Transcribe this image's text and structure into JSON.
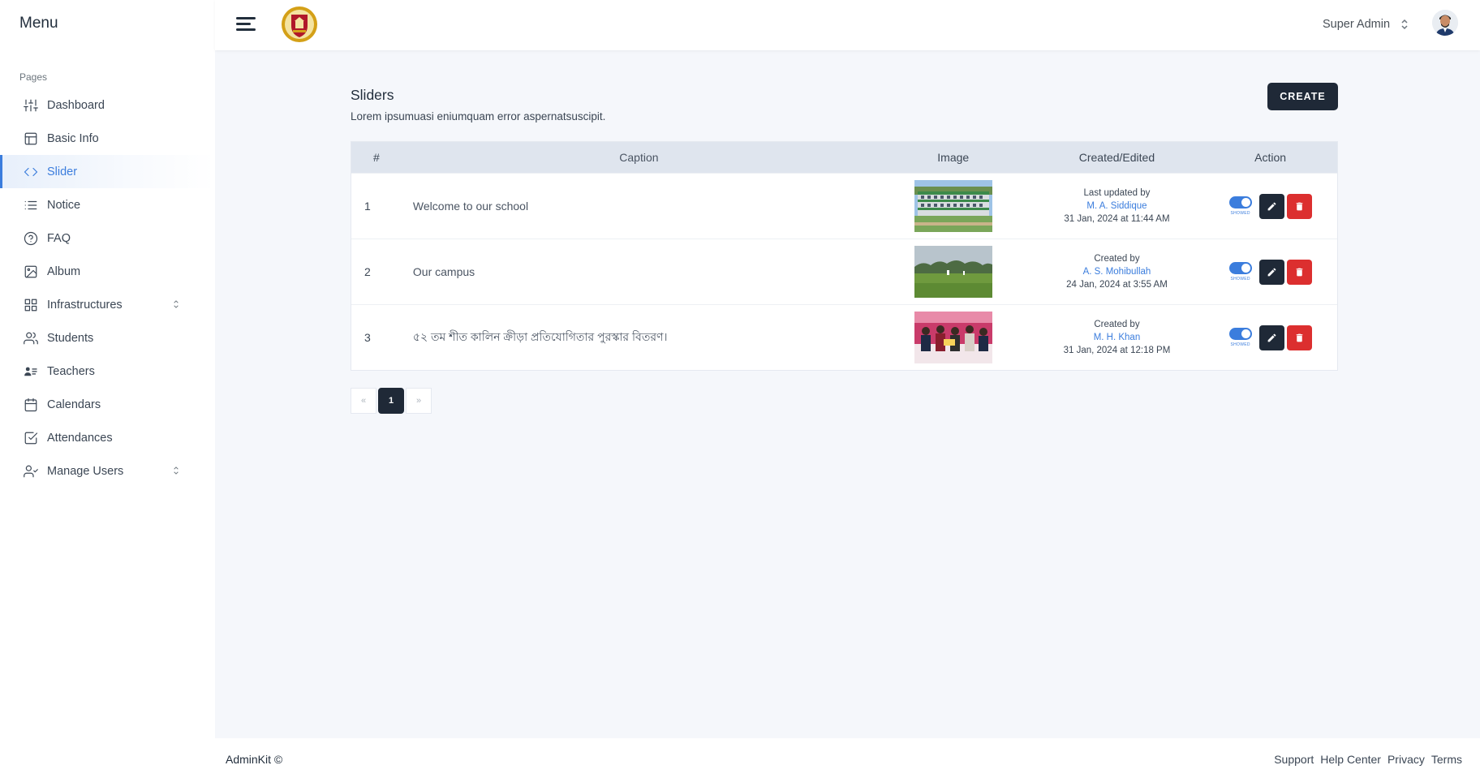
{
  "sidebar": {
    "title": "Menu",
    "section_label": "Pages",
    "items": [
      {
        "label": "Dashboard",
        "icon": "sliders-icon"
      },
      {
        "label": "Basic Info",
        "icon": "layout-icon"
      },
      {
        "label": "Slider",
        "icon": "code-icon",
        "active": true
      },
      {
        "label": "Notice",
        "icon": "list-icon"
      },
      {
        "label": "FAQ",
        "icon": "help-circle-icon"
      },
      {
        "label": "Album",
        "icon": "image-icon"
      },
      {
        "label": "Infrastructures",
        "icon": "grid-icon",
        "expandable": true
      },
      {
        "label": "Students",
        "icon": "users-icon"
      },
      {
        "label": "Teachers",
        "icon": "id-card-icon"
      },
      {
        "label": "Calendars",
        "icon": "calendar-icon"
      },
      {
        "label": "Attendances",
        "icon": "check-square-icon"
      },
      {
        "label": "Manage Users",
        "icon": "user-check-icon",
        "expandable": true
      }
    ]
  },
  "header": {
    "user_name": "Super Admin"
  },
  "page": {
    "title": "Sliders",
    "description": "Lorem ipsumuasi eniumquam error aspernatsuscipit.",
    "create_label": "CREATE"
  },
  "table": {
    "headers": {
      "num": "#",
      "caption": "Caption",
      "image": "Image",
      "created": "Created/Edited",
      "action": "Action"
    },
    "rows": [
      {
        "num": "1",
        "caption": "Welcome to our school",
        "created_label": "Last updated by",
        "by": "M. A. Siddique",
        "date": "31 Jan, 2024 at 11:44 AM",
        "toggle_label": "SHOWED"
      },
      {
        "num": "2",
        "caption": "Our campus",
        "created_label": "Created by",
        "by": "A. S. Mohibullah",
        "date": "24 Jan, 2024 at 3:55 AM",
        "toggle_label": "SHOWED"
      },
      {
        "num": "3",
        "caption": "৫২ তম শীত কালিন ক্রীড়া প্রতিযোগিতার পুরস্কার বিতরণ।",
        "created_label": "Created by",
        "by": "M. H. Khan",
        "date": "31 Jan, 2024 at 12:18 PM",
        "toggle_label": "SHOWED"
      }
    ]
  },
  "pagination": {
    "prev": "«",
    "current": "1",
    "next": "»"
  },
  "footer": {
    "brand": "AdminKit ©",
    "links": [
      "Support",
      "Help Center",
      "Privacy",
      "Terms"
    ]
  },
  "colors": {
    "accent": "#3b7ddd",
    "dark": "#1f2937",
    "danger": "#dc2f2f",
    "background": "#f5f7fb"
  }
}
